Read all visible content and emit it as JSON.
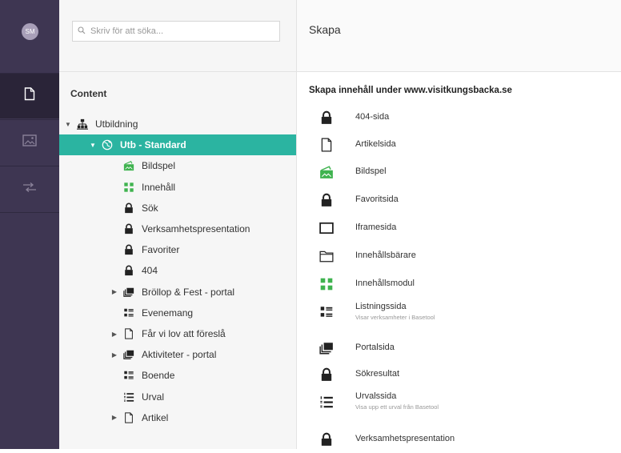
{
  "user": {
    "initials": "SM"
  },
  "sections": [
    {
      "id": "content",
      "icon": "document-icon",
      "active": true
    },
    {
      "id": "media",
      "icon": "image-icon",
      "active": false
    },
    {
      "id": "translation",
      "icon": "swap-arrows-icon",
      "active": false
    }
  ],
  "search": {
    "placeholder": "Skriv för att söka..."
  },
  "tree": {
    "title": "Content",
    "nodes": [
      {
        "label": "Utbildning",
        "icon": "sitemap-icon",
        "caret": "down",
        "indent": 0,
        "selected": false
      },
      {
        "label": "Utb - Standard",
        "icon": "globe-icon",
        "caret": "down",
        "indent": 1,
        "selected": true
      },
      {
        "label": "Bildspel",
        "icon": "slideshow-icon",
        "caret": "",
        "indent": 2,
        "selected": false
      },
      {
        "label": "Innehåll",
        "icon": "modules-icon",
        "caret": "",
        "indent": 2,
        "selected": false
      },
      {
        "label": "Sök",
        "icon": "lock-icon",
        "caret": "",
        "indent": 2,
        "selected": false
      },
      {
        "label": "Verksamhetspresentation",
        "icon": "lock-icon",
        "caret": "",
        "indent": 2,
        "selected": false
      },
      {
        "label": "Favoriter",
        "icon": "lock-icon",
        "caret": "",
        "indent": 2,
        "selected": false
      },
      {
        "label": "404",
        "icon": "lock-icon",
        "caret": "",
        "indent": 2,
        "selected": false
      },
      {
        "label": "Bröllop & Fest - portal",
        "icon": "portal-icon",
        "caret": "right",
        "indent": 2,
        "selected": false
      },
      {
        "label": "Evenemang",
        "icon": "listing-icon",
        "caret": "",
        "indent": 2,
        "selected": false
      },
      {
        "label": "Får vi lov att föreslå",
        "icon": "document-icon",
        "caret": "right",
        "indent": 2,
        "selected": false
      },
      {
        "label": "Aktiviteter - portal",
        "icon": "portal-icon",
        "caret": "right",
        "indent": 2,
        "selected": false
      },
      {
        "label": "Boende",
        "icon": "listing-icon",
        "caret": "",
        "indent": 2,
        "selected": false
      },
      {
        "label": "Urval",
        "icon": "numbered-list-icon",
        "caret": "",
        "indent": 2,
        "selected": false
      },
      {
        "label": "Artikel",
        "icon": "document-icon",
        "caret": "right",
        "indent": 2,
        "selected": false
      }
    ]
  },
  "create": {
    "title": "Skapa",
    "subtitle": "Skapa innehåll under www.visitkungsbacka.se",
    "doc_types": [
      {
        "name": "404-sida",
        "icon": "lock-icon",
        "description": ""
      },
      {
        "name": "Artikelsida",
        "icon": "document-icon",
        "description": ""
      },
      {
        "name": "Bildspel",
        "icon": "slideshow-icon",
        "description": ""
      },
      {
        "name": "Favoritsida",
        "icon": "lock-icon",
        "description": ""
      },
      {
        "name": "Iframesida",
        "icon": "frame-icon",
        "description": ""
      },
      {
        "name": "Innehållsbärare",
        "icon": "folder-icon",
        "description": ""
      },
      {
        "name": "Innehållsmodul",
        "icon": "modules-icon",
        "description": ""
      },
      {
        "name": "Listningssida",
        "icon": "listing-icon",
        "description": "Visar verksamheter i Basetool"
      },
      {
        "name": "Portalsida",
        "icon": "portal-icon",
        "description": ""
      },
      {
        "name": "Sökresultat",
        "icon": "lock-icon",
        "description": ""
      },
      {
        "name": "Urvalssida",
        "icon": "numbered-list-icon",
        "description": "Visa upp ett urval från Basetool"
      },
      {
        "name": "Verksamhetspresentation",
        "icon": "lock-icon",
        "description": ""
      }
    ]
  },
  "colors": {
    "sidebar": "#3e3652",
    "selected": "#2bb4a1",
    "green": "#3fb34f"
  }
}
